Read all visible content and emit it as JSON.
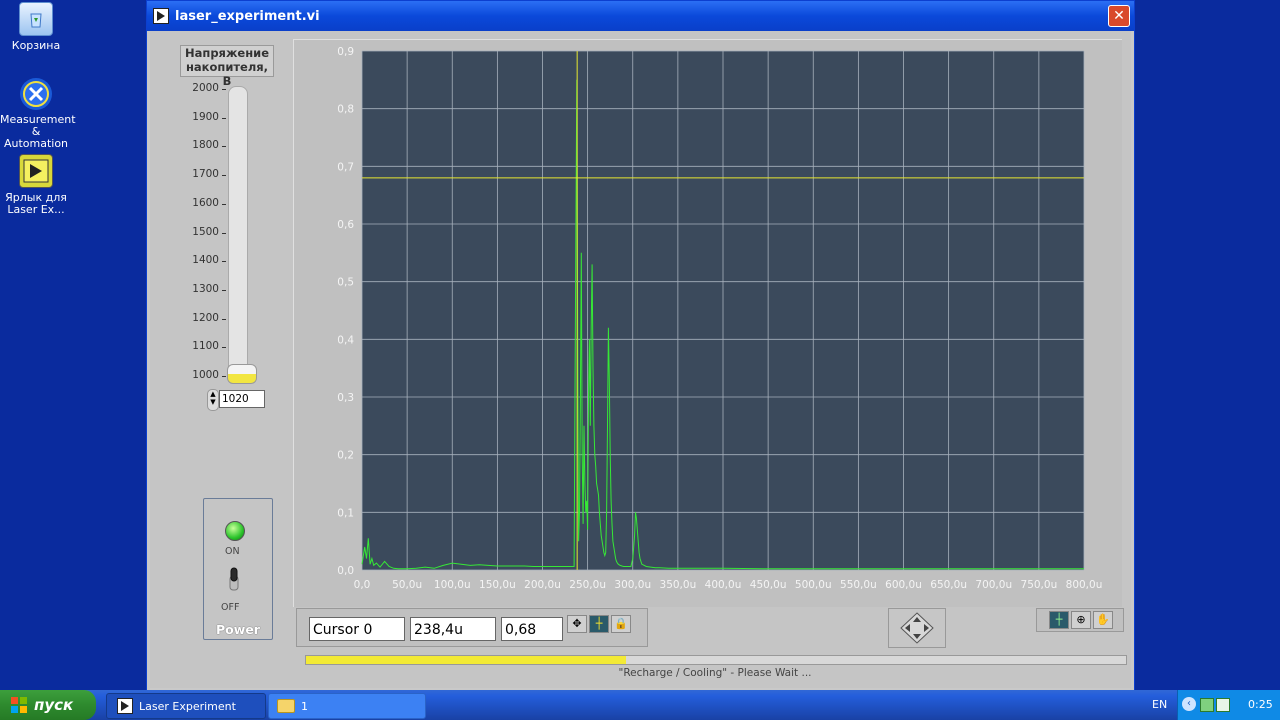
{
  "desktop": {
    "icons": [
      {
        "label_line1": "Корзина",
        "label_line2": ""
      },
      {
        "label_line1": "Measurement",
        "label_line2": "& Automation"
      },
      {
        "label_line1": "Ярлык для",
        "label_line2": "Laser Ex..."
      }
    ]
  },
  "window": {
    "title": "laser_experiment.vi",
    "close_symbol": "✕"
  },
  "voltage": {
    "label_line1": "Напряжение",
    "label_line2": "накопителя, В",
    "ticks": [
      "2000",
      "1900",
      "1800",
      "1700",
      "1600",
      "1500",
      "1400",
      "1300",
      "1200",
      "1100",
      "1000"
    ],
    "value": "1020",
    "min": 1000,
    "max": 2000
  },
  "power": {
    "on_label": "ON",
    "off_label": "OFF",
    "title": "Power",
    "led_color": "#2bc42b",
    "state": "on"
  },
  "chart_data": {
    "type": "line",
    "xlim": [
      0,
      800
    ],
    "ylim": [
      0,
      0.9
    ],
    "x_ticks": [
      "0,0",
      "50,0u",
      "100,0u",
      "150,0u",
      "200,0u",
      "250,0u",
      "300,0u",
      "350,0u",
      "400,0u",
      "450,0u",
      "500,0u",
      "550,0u",
      "600,0u",
      "650,0u",
      "700,0u",
      "750,0u",
      "800,0u"
    ],
    "y_ticks": [
      "0,0",
      "0,1",
      "0,2",
      "0,3",
      "0,4",
      "0,5",
      "0,6",
      "0,7",
      "0,8",
      "0,9"
    ],
    "plot_bg": "#3b4a5c",
    "grid": true,
    "series_color": "#36e836",
    "cursor": {
      "x": 238.4,
      "y": 0.68,
      "color": "#e8e830"
    },
    "series": [
      {
        "x": [
          0,
          3,
          5,
          7,
          9,
          11,
          13,
          16,
          20,
          25,
          30,
          35,
          40,
          50,
          60,
          70,
          80,
          90,
          100,
          110,
          120,
          130,
          140,
          150,
          160,
          170,
          180,
          190,
          200,
          210,
          220,
          230,
          235,
          237,
          238,
          239,
          240,
          241,
          242,
          243,
          244,
          245,
          246,
          247,
          248,
          249,
          250,
          251,
          252,
          253,
          254,
          255,
          256,
          257,
          258,
          259,
          260,
          261,
          262,
          263,
          264,
          265,
          266,
          267,
          268,
          269,
          270,
          271,
          272,
          273,
          274,
          275,
          276,
          277,
          278,
          279,
          280,
          281,
          282,
          283,
          284,
          286,
          288,
          290,
          292,
          295,
          298,
          300,
          302,
          303,
          304,
          305,
          306,
          307,
          308,
          310,
          315,
          320,
          325,
          330,
          340,
          350,
          400,
          450,
          500,
          550,
          600,
          650,
          700,
          750,
          800
        ],
        "y": [
          0.01,
          0.04,
          0.02,
          0.055,
          0.01,
          0.02,
          0.008,
          0.012,
          0.005,
          0.015,
          0.006,
          0.003,
          0.002,
          0.002,
          0.003,
          0.005,
          0.003,
          0.008,
          0.012,
          0.01,
          0.008,
          0.009,
          0.008,
          0.007,
          0.007,
          0.007,
          0.007,
          0.006,
          0.006,
          0.006,
          0.006,
          0.006,
          0.006,
          0.6,
          0.85,
          0.4,
          0.05,
          0.1,
          0.3,
          0.55,
          0.2,
          0.08,
          0.25,
          0.15,
          0.1,
          0.12,
          0.07,
          0.3,
          0.4,
          0.25,
          0.42,
          0.53,
          0.35,
          0.25,
          0.2,
          0.18,
          0.15,
          0.14,
          0.13,
          0.1,
          0.08,
          0.06,
          0.05,
          0.04,
          0.03,
          0.025,
          0.03,
          0.1,
          0.25,
          0.42,
          0.33,
          0.2,
          0.12,
          0.08,
          0.05,
          0.04,
          0.03,
          0.02,
          0.015,
          0.012,
          0.01,
          0.008,
          0.007,
          0.006,
          0.006,
          0.006,
          0.006,
          0.02,
          0.06,
          0.1,
          0.09,
          0.07,
          0.05,
          0.03,
          0.02,
          0.01,
          0.006,
          0.005,
          0.004,
          0.004,
          0.003,
          0.003,
          0.003,
          0.002,
          0.002,
          0.002,
          0.002,
          0.002,
          0.002,
          0.002,
          0.002
        ]
      }
    ]
  },
  "cursor_legend": {
    "name": "Cursor 0",
    "x_value": "238,4u",
    "y_value": "0,68"
  },
  "status": {
    "progress": 0.39,
    "text": "\"Recharge  / Cooling\" - Please Wait ..."
  },
  "taskbar": {
    "start_label": "пуск",
    "tasks": [
      "Laser Experiment",
      "1"
    ],
    "lang": "EN",
    "clock": "0:25"
  }
}
